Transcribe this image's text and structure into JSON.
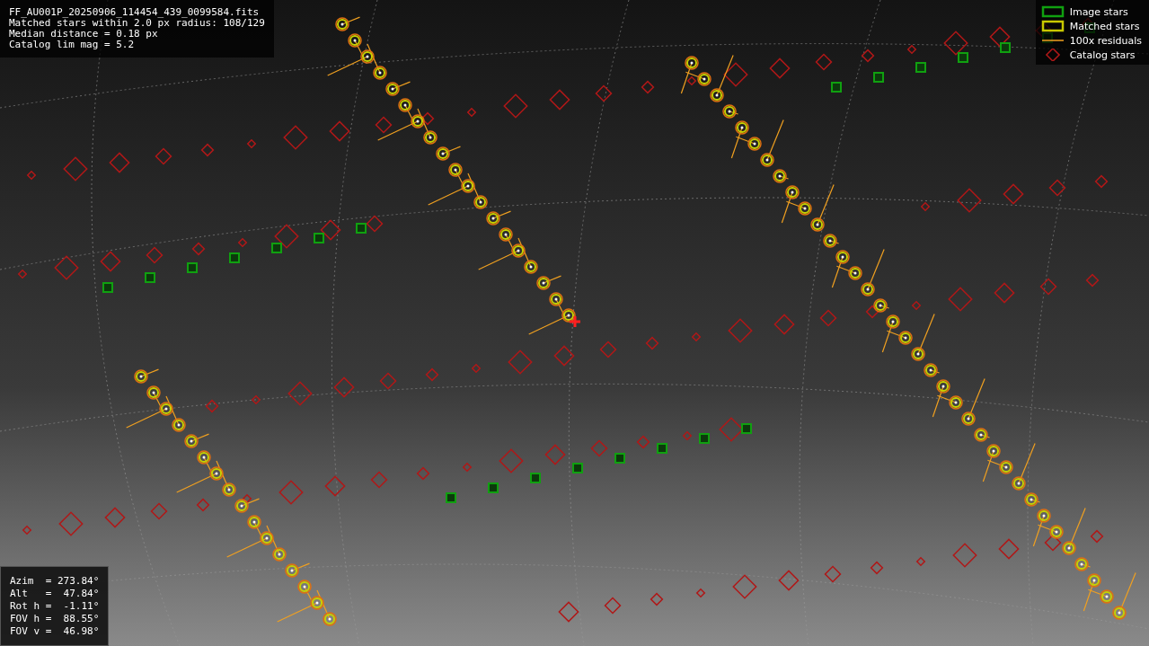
{
  "file_info": {
    "lines": [
      "FF_AU001P_20250906_114454_439_0099584.fits",
      "Matched stars within 2.0 px radius: 108/129",
      "Median distance = 0.18 px",
      "Catalog lim mag = 5.2"
    ]
  },
  "legend": {
    "items": [
      {
        "label": "Image stars",
        "kind": "image"
      },
      {
        "label": "Matched stars",
        "kind": "matched"
      },
      {
        "label": "100x residuals",
        "kind": "residual"
      },
      {
        "label": "Catalog stars",
        "kind": "catalog"
      }
    ]
  },
  "pointing": {
    "lines": [
      "Azim  = 273.84°",
      "Alt   =  47.84°",
      "Rot h =  -1.11°",
      "FOV h =  88.55°",
      "FOV v =  46.98°"
    ]
  }
}
